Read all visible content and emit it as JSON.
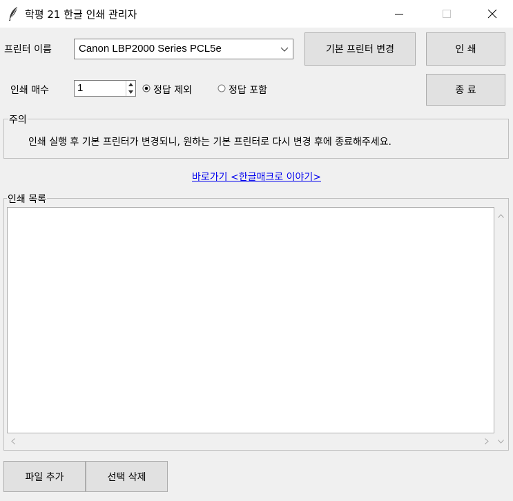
{
  "window": {
    "title": "학평 21 한글 인쇄 관리자",
    "icon": "feather-icon",
    "controls": {
      "minimize": "—",
      "maximize": "□",
      "close": "✕"
    }
  },
  "printer": {
    "label": "프린터 이름",
    "selected": "Canon LBP2000 Series PCL5e",
    "set_default_button": "기본 프린터 변경",
    "print_button": "인 쇄"
  },
  "copies": {
    "label": "인쇄 매수",
    "value": "1"
  },
  "answer_options": {
    "exclude": {
      "label": "정답 제외",
      "checked": true
    },
    "include": {
      "label": "정답 포함",
      "checked": false
    }
  },
  "exit_button": "종 료",
  "notice": {
    "legend": "주의",
    "text": "인쇄 실행 후 기본 프린터가 변경되니, 원하는 기본 프린터로 다시 변경 후에 종료해주세요."
  },
  "link_text": "바로가기 <한글매크로 이야기>",
  "print_list": {
    "legend": "인쇄 목록",
    "items": []
  },
  "bottom": {
    "add_file_button": "파일 추가",
    "delete_selected_button": "선택 삭제"
  },
  "colors": {
    "link": "#0000ee",
    "background": "#f0f0f0"
  }
}
